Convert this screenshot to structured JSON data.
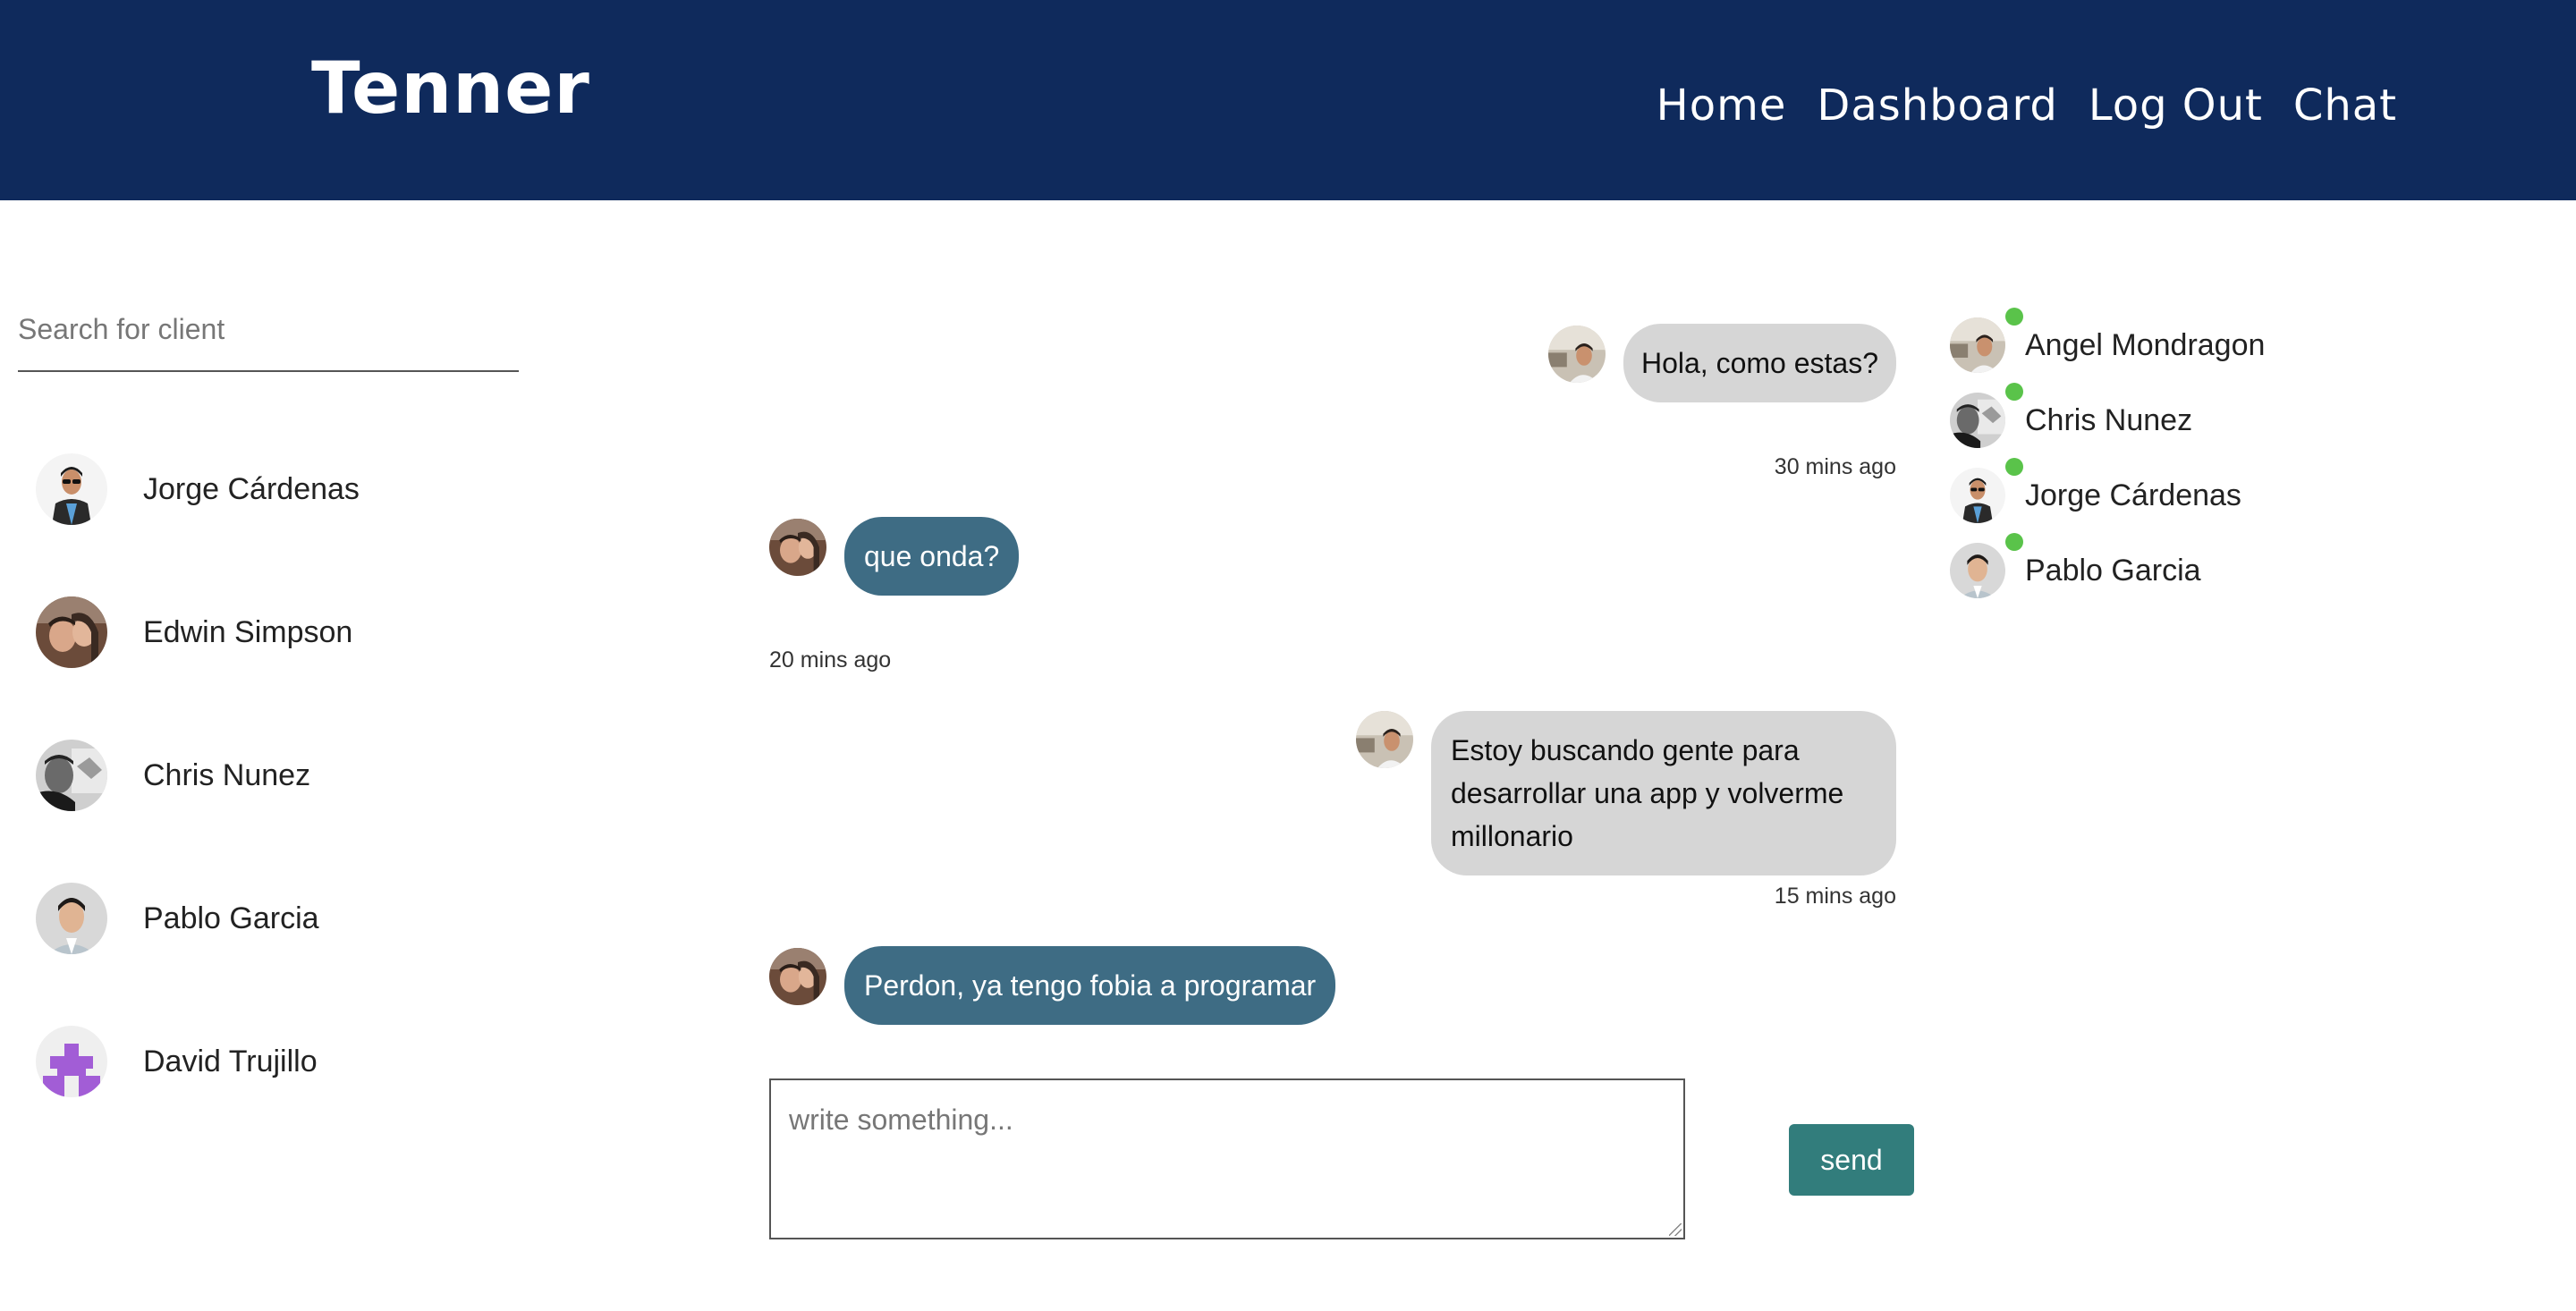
{
  "header": {
    "brand": "Tenner",
    "nav": [
      "Home",
      "Dashboard",
      "Log Out",
      "Chat"
    ],
    "background": "#0f2a5c"
  },
  "sidebar": {
    "search_placeholder": "Search for client",
    "clients": [
      {
        "name": "Jorge Cárdenas",
        "avatar": "man-sunglasses-avatar"
      },
      {
        "name": "Edwin Simpson",
        "avatar": "couple-selfie-avatar"
      },
      {
        "name": "Chris Nunez",
        "avatar": "bw-selfie-avatar"
      },
      {
        "name": "Pablo Garcia",
        "avatar": "young-man-portrait-avatar"
      },
      {
        "name": "David Trujillo",
        "avatar": "purple-identicon-avatar"
      }
    ]
  },
  "chat": {
    "messages": [
      {
        "text": "Hola, como estas?",
        "time": "30 mins ago",
        "side": "right",
        "style": "incoming"
      },
      {
        "text": "que onda?",
        "time": "20 mins ago",
        "side": "left",
        "style": "outgoing"
      },
      {
        "text": "Estoy buscando gente para desarrollar una app y volverme millonario",
        "time": "15 mins ago",
        "side": "right",
        "style": "incoming"
      },
      {
        "text": "Perdon, ya tengo fobia a programar",
        "time": "",
        "side": "left",
        "style": "outgoing"
      }
    ],
    "composer_placeholder": "write something...",
    "send_label": "send",
    "bubble_in_color": "#d6d6d6",
    "bubble_out_color": "#3e6c84",
    "send_color": "#327d7c"
  },
  "online": {
    "users": [
      {
        "name": "Angel Mondragon",
        "avatar": "man-outdoor-avatar"
      },
      {
        "name": "Chris Nunez",
        "avatar": "bw-selfie-avatar"
      },
      {
        "name": "Jorge Cárdenas",
        "avatar": "man-sunglasses-avatar"
      },
      {
        "name": "Pablo Garcia",
        "avatar": "young-man-portrait-avatar"
      }
    ],
    "status_color": "#5ac34a"
  }
}
